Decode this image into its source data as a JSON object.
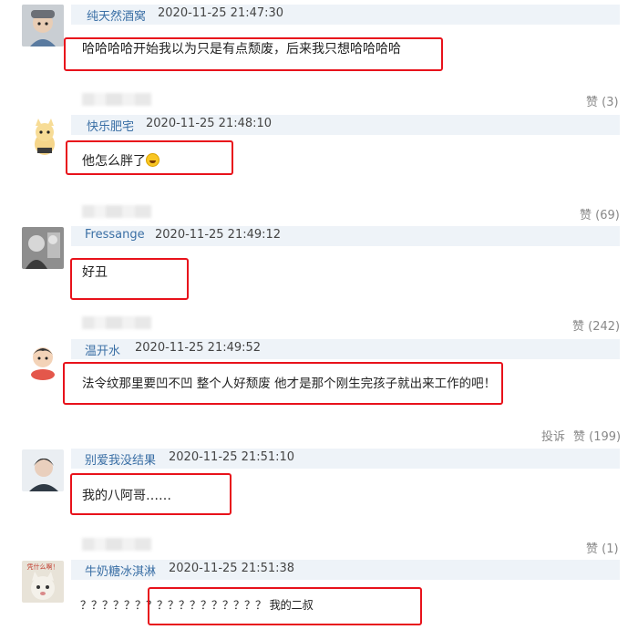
{
  "comments": [
    {
      "username": "纯天然酒窝",
      "time": "2020-11-25 21:47:30",
      "text": "哈哈哈哈开始我以为只是有点颓废，后来我只想哈哈哈哈",
      "likes": "赞 (3)"
    },
    {
      "username": "快乐肥宅",
      "time": "2020-11-25 21:48:10",
      "text": "他怎么胖了",
      "likes": "赞 (69)"
    },
    {
      "username": "Fressange",
      "time": "2020-11-25 21:49:12",
      "text": "好丑",
      "likes": "赞 (242)"
    },
    {
      "username": "温开水",
      "time": "2020-11-25 21:49:52",
      "text": "法令纹那里要凹不凹 整个人好颓废 他才是那个刚生完孩子就出来工作的吧！",
      "likes": "赞 (199)",
      "report": "投诉"
    },
    {
      "username": "别爱我没结果",
      "time": "2020-11-25 21:51:10",
      "text": "我的八阿哥……",
      "likes": "赞 (1)"
    },
    {
      "username": "牛奶糖冰淇淋",
      "time": "2020-11-25 21:51:38",
      "text": "？？？？？？？？？？？？？？？？？ 我的二叔"
    }
  ],
  "avatar_labels": {
    "c6": "凭什么啊！"
  },
  "colors": {
    "username": "#3a6fa5",
    "header_bg": "#eef3f8",
    "highlight": "#e8121b"
  }
}
